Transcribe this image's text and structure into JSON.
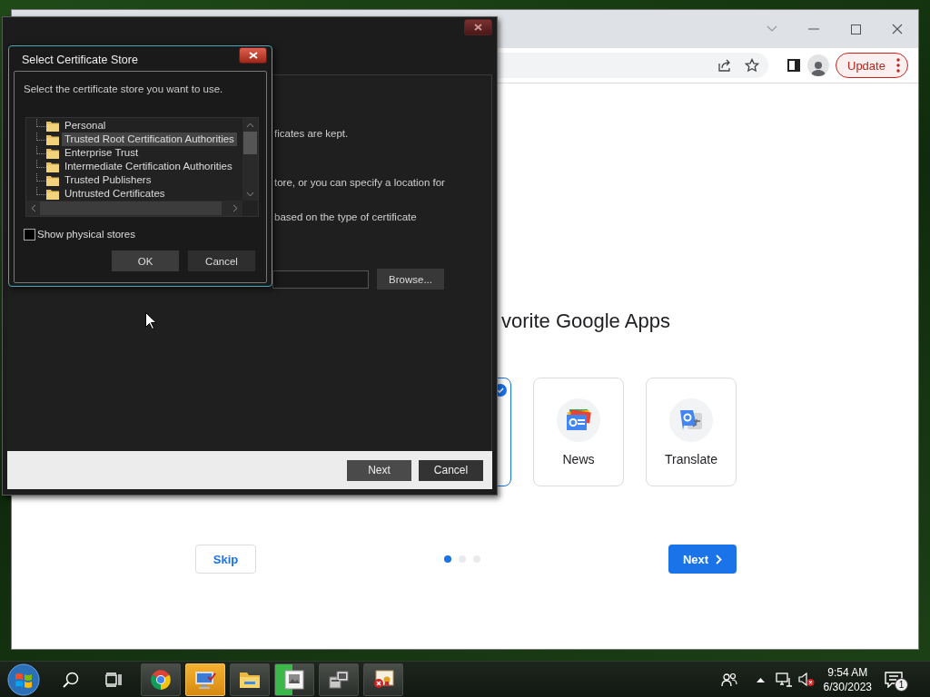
{
  "browser": {
    "update_button": "Update",
    "heading": "vorite Google Apps",
    "apps": [
      {
        "selected": true
      },
      {
        "label": "News",
        "selected": false
      },
      {
        "label": "Translate",
        "selected": false
      }
    ],
    "skip_button": "Skip",
    "pager": [
      {
        "selected": true
      },
      {
        "selected": false
      },
      {
        "selected": false
      }
    ],
    "next_button": "Next"
  },
  "wizard": {
    "lines": [
      "ficates are kept.",
      "tore, or you can specify a location for",
      "based on the type of certificate"
    ],
    "browse_button": "Browse...",
    "buttons": [
      "Next",
      "Cancel"
    ]
  },
  "cert_dialog": {
    "title": "Select Certificate Store",
    "prompt": "Select the certificate store you want to use.",
    "stores": [
      {
        "label": "Personal",
        "selected": false
      },
      {
        "label": "Trusted Root Certification Authorities",
        "selected": true
      },
      {
        "label": "Enterprise Trust",
        "selected": false
      },
      {
        "label": "Intermediate Certification Authorities",
        "selected": false
      },
      {
        "label": "Trusted Publishers",
        "selected": false
      },
      {
        "label": "Untrusted Certificates",
        "selected": false
      }
    ],
    "show_physical_stores": {
      "label": "Show physical stores",
      "checked": false
    },
    "buttons": [
      "OK",
      "Cancel"
    ]
  },
  "taskbar": {
    "apps": [
      {
        "selected": false
      },
      {
        "selected": true
      },
      {
        "selected": false
      },
      {
        "selected": false,
        "level": 0.45
      },
      {
        "selected": false
      },
      {
        "selected": false
      }
    ],
    "time": "9:54 AM",
    "date": "6/30/2023",
    "notification_count": "1"
  }
}
